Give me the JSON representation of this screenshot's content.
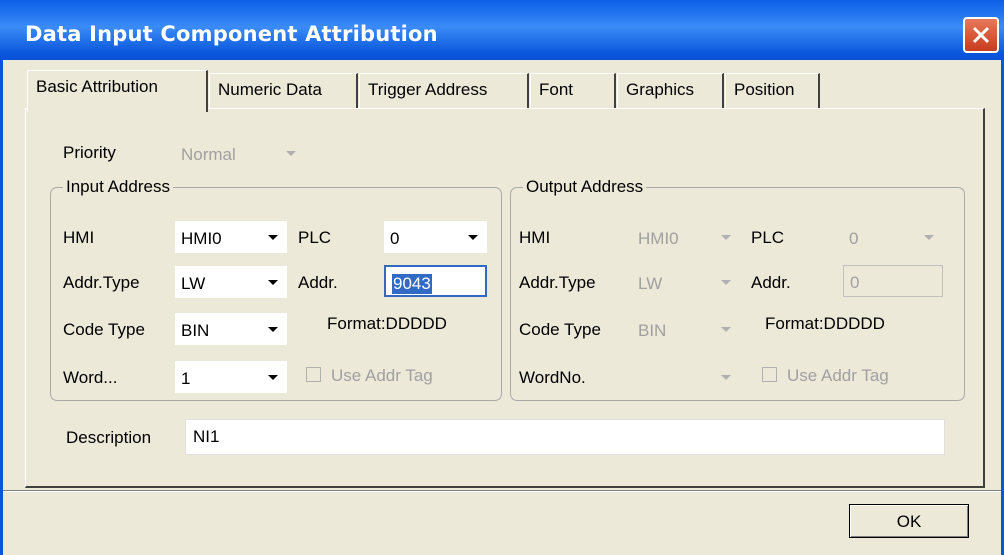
{
  "window": {
    "title": "Data Input Component Attribution"
  },
  "tabs": [
    {
      "label": "Basic Attribution",
      "active": true
    },
    {
      "label": "Numeric Data"
    },
    {
      "label": "Trigger Address"
    },
    {
      "label": "Font"
    },
    {
      "label": "Graphics"
    },
    {
      "label": "Position"
    }
  ],
  "priority": {
    "label": "Priority",
    "value": "Normal"
  },
  "input_address": {
    "legend": "Input Address",
    "hmi_label": "HMI",
    "hmi_value": "HMI0",
    "plc_label": "PLC",
    "plc_value": "0",
    "addr_type_label": "Addr.Type",
    "addr_type_value": "LW",
    "addr_label": "Addr.",
    "addr_value": "9043",
    "code_type_label": "Code Type",
    "code_type_value": "BIN",
    "format_text": "Format:DDDDD",
    "word_label": "Word...",
    "word_value": "1",
    "use_addr_tag_label": "Use Addr Tag"
  },
  "output_address": {
    "legend": "Output Address",
    "hmi_label": "HMI",
    "hmi_value": "HMI0",
    "plc_label": "PLC",
    "plc_value": "0",
    "addr_type_label": "Addr.Type",
    "addr_type_value": "LW",
    "addr_label": "Addr.",
    "addr_value": "0",
    "code_type_label": "Code Type",
    "code_type_value": "BIN",
    "format_text": "Format:DDDDD",
    "word_label": "WordNo.",
    "word_value": "",
    "use_addr_tag_label": "Use Addr Tag"
  },
  "description": {
    "label": "Description",
    "value": "NI1"
  },
  "buttons": {
    "ok_label": "OK"
  },
  "colors": {
    "titlebar": "#0a55dc",
    "selection": "#316ac5",
    "face": "#ece9d8"
  }
}
